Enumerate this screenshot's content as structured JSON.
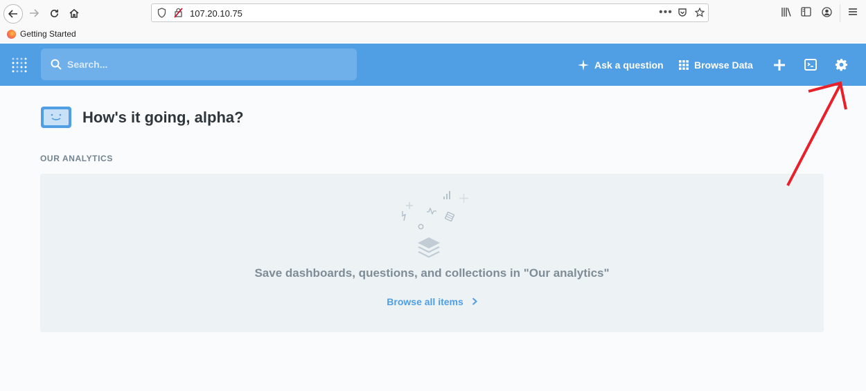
{
  "browser": {
    "url": "107.20.10.75",
    "bookmark": "Getting Started"
  },
  "header": {
    "search_placeholder": "Search...",
    "ask_question": "Ask a question",
    "browse_data": "Browse Data"
  },
  "main": {
    "greeting": "How's it going, alpha?",
    "section_title": "OUR ANALYTICS",
    "empty_message": "Save dashboards, questions, and collections in \"Our analytics\"",
    "browse_link": "Browse all items"
  },
  "colors": {
    "brand": "#509ee3",
    "annotation": "#e8202a"
  },
  "icons": [
    "back-icon",
    "forward-icon",
    "reload-icon",
    "home-icon",
    "shield-icon",
    "lock-warning-icon",
    "more-icon",
    "pocket-icon",
    "star-icon",
    "library-icon",
    "sidebar-icon",
    "account-icon",
    "menu-icon",
    "metabase-logo",
    "search-icon",
    "sparkle-icon",
    "grid-icon",
    "plus-icon",
    "sql-icon",
    "gear-icon"
  ]
}
